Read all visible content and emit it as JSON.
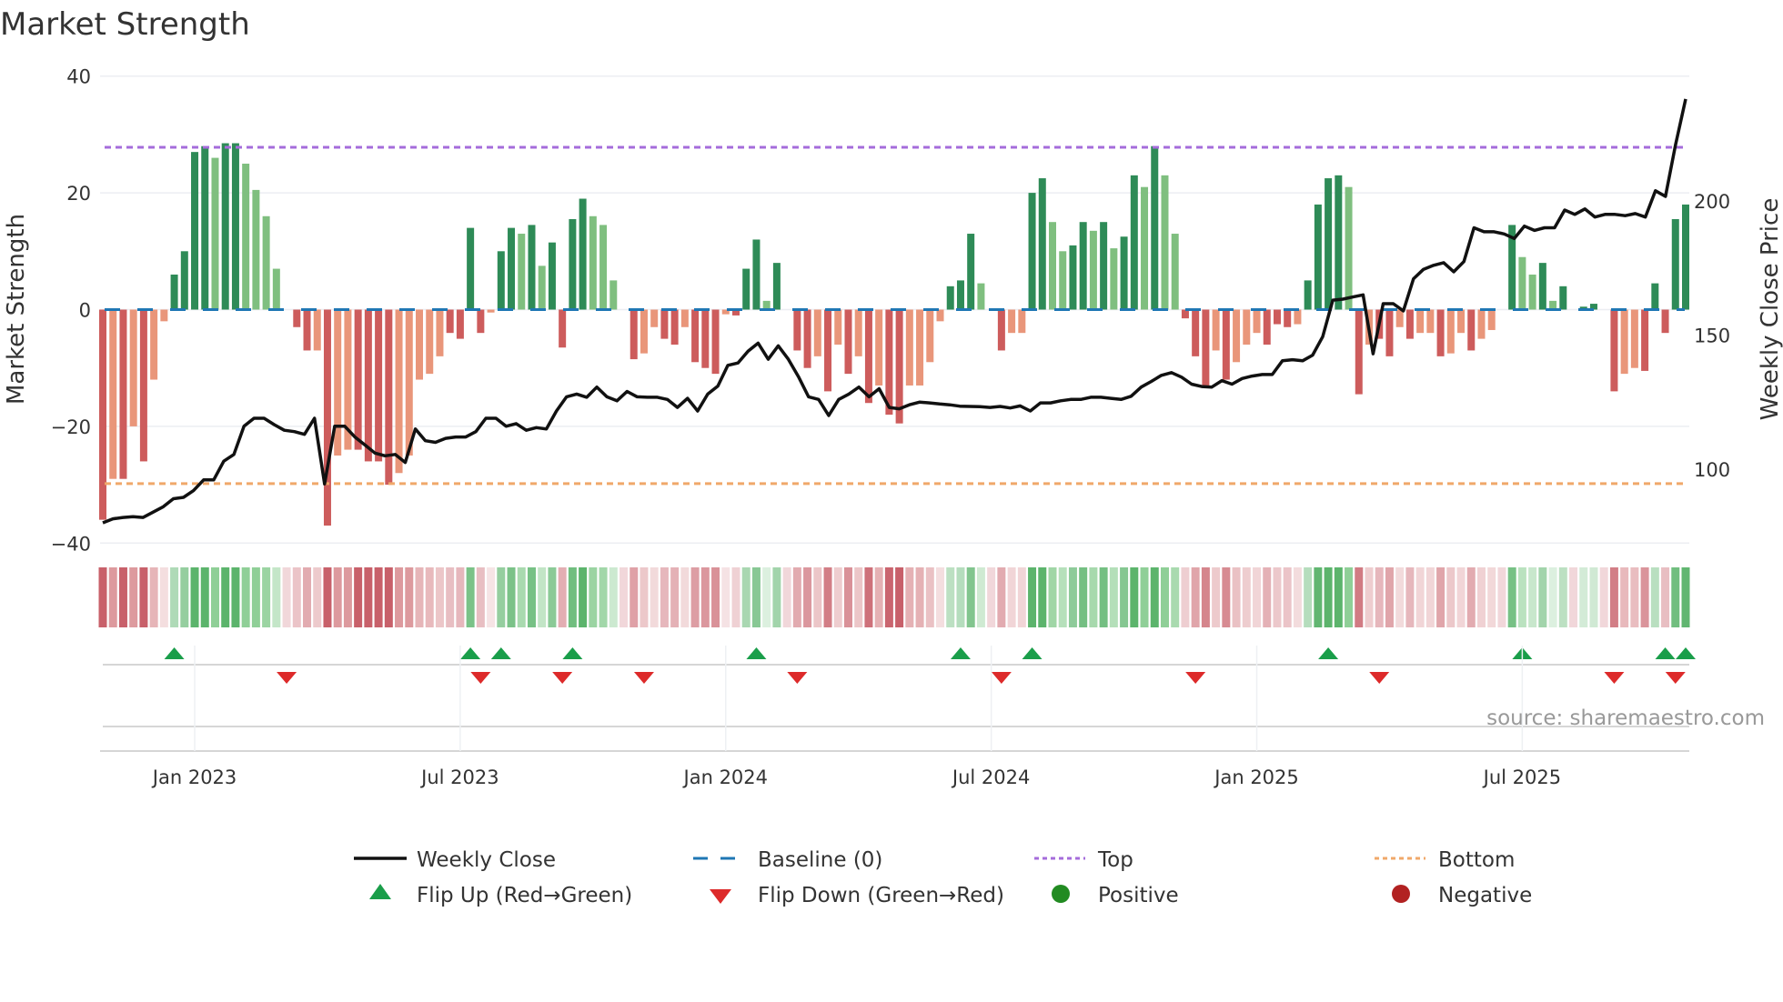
{
  "chart_data": {
    "type": "bar",
    "title": "Market Strength",
    "ylabel": "Market Strength",
    "y2label": "Weekly Close Price",
    "ylim": [
      -40,
      40
    ],
    "y2_ticks": [
      100,
      150,
      200
    ],
    "yticks": [
      -40,
      -20,
      0,
      20,
      40
    ],
    "ytick_labels": [
      "−40",
      "−20",
      "0",
      "20",
      "40"
    ],
    "y2tick_labels": [
      "100",
      "150",
      "200"
    ],
    "top_level": 27.8,
    "bottom_level": -29.8,
    "baseline": 0,
    "x_ticks": [
      {
        "week": 9,
        "label": "Jan 2023"
      },
      {
        "week": 35,
        "label": "Jul 2023"
      },
      {
        "week": 61,
        "label": "Jan 2024"
      },
      {
        "week": 87,
        "label": "Jul 2024"
      },
      {
        "week": 113,
        "label": "Jan 2025"
      },
      {
        "week": 139,
        "label": "Jul 2025"
      }
    ],
    "strength": [
      -36,
      -29,
      -29,
      -20,
      -26,
      -12,
      -2,
      6,
      10,
      27,
      28,
      26,
      28.5,
      28.5,
      25,
      20.5,
      16,
      7,
      0,
      -3,
      -7,
      -7,
      -37,
      -25,
      -24,
      -24,
      -26,
      -26,
      -30,
      -28,
      -25,
      -12,
      -11,
      -8,
      -4,
      -5,
      14,
      -4,
      -0.5,
      10,
      14,
      13,
      14.5,
      7.5,
      11.5,
      -6.5,
      15.5,
      19,
      16,
      14.5,
      5,
      0,
      -8.5,
      -7.5,
      -3,
      -5,
      -6,
      -3,
      -9,
      -10,
      -11,
      -0.8,
      -1,
      7,
      12,
      1.5,
      8,
      0,
      -7,
      -10,
      -8,
      -14,
      -6,
      -11,
      -8,
      -16,
      -13,
      -18,
      -19.5,
      -13,
      -13,
      -9,
      -2,
      4,
      5,
      13,
      4.5,
      0,
      -7,
      -4,
      -4,
      20,
      22.5,
      15,
      10,
      11,
      15,
      13.5,
      15,
      10.5,
      12.5,
      23,
      21,
      28,
      23,
      13,
      -1.5,
      -8,
      -13,
      -7,
      -12,
      -9,
      -6,
      -4,
      -6,
      -2.5,
      -3,
      -2.5,
      5,
      18,
      22.5,
      23,
      21,
      -14.5,
      -6,
      -5,
      -8,
      -3,
      -5,
      -4,
      -4,
      -8,
      -7.5,
      -4,
      -7,
      -5,
      -3.5,
      0,
      14.5,
      9,
      6,
      8,
      1.5,
      4,
      0,
      0.5,
      1,
      0,
      -14,
      -11,
      -10,
      -10.5,
      4.5,
      -4,
      15.5,
      18
    ],
    "shade": [
      "d",
      "l",
      "d",
      "l",
      "d",
      "l",
      "l",
      "d",
      "d",
      "d",
      "d",
      "l",
      "d",
      "d",
      "l",
      "l",
      "l",
      "l",
      "d",
      "d",
      "d",
      "l",
      "d",
      "l",
      "l",
      "d",
      "d",
      "d",
      "d",
      "l",
      "l",
      "l",
      "l",
      "l",
      "d",
      "d",
      "d",
      "d",
      "l",
      "d",
      "d",
      "l",
      "d",
      "l",
      "d",
      "d",
      "d",
      "d",
      "l",
      "l",
      "l",
      "d",
      "d",
      "l",
      "l",
      "d",
      "d",
      "l",
      "d",
      "d",
      "d",
      "l",
      "d",
      "d",
      "d",
      "l",
      "d",
      "d",
      "d",
      "d",
      "l",
      "d",
      "l",
      "d",
      "l",
      "d",
      "l",
      "d",
      "d",
      "l",
      "l",
      "l",
      "l",
      "d",
      "d",
      "d",
      "l",
      "d",
      "d",
      "l",
      "l",
      "d",
      "d",
      "l",
      "l",
      "d",
      "d",
      "l",
      "d",
      "l",
      "d",
      "d",
      "l",
      "d",
      "l",
      "l",
      "d",
      "d",
      "d",
      "l",
      "d",
      "l",
      "l",
      "l",
      "d",
      "d",
      "d",
      "l",
      "d",
      "d",
      "d",
      "d",
      "l",
      "d",
      "l",
      "d",
      "d",
      "l",
      "d",
      "l",
      "l",
      "d",
      "l",
      "l",
      "d",
      "l",
      "l",
      "d",
      "d",
      "l",
      "l",
      "d",
      "l",
      "d",
      "d",
      "d",
      "d",
      "d",
      "d",
      "l",
      "l",
      "d",
      "d",
      "d",
      "d",
      "d"
    ],
    "weekly_close": [
      80,
      81.5,
      82,
      82.3,
      82,
      84,
      86,
      89,
      89.5,
      92,
      96,
      96,
      103,
      105.5,
      116,
      119,
      119,
      116.6,
      114.5,
      114,
      113,
      119,
      94.5,
      116,
      116,
      112,
      109,
      106,
      105,
      105.5,
      102.5,
      115,
      110.6,
      110,
      111.5,
      112,
      112,
      114,
      119,
      119,
      116,
      117,
      114.5,
      115.5,
      115,
      121.7,
      127,
      128,
      126.8,
      130.6,
      127,
      125.5,
      129,
      127,
      126.8,
      126.8,
      126,
      123,
      126.4,
      121.7,
      128,
      131,
      138.7,
      139.6,
      144,
      147,
      141,
      146,
      141,
      134.5,
      127,
      126,
      120,
      126,
      128,
      130.6,
      127,
      130,
      123,
      122.5,
      124,
      125,
      124.7,
      124.3,
      124,
      123.5,
      123.4,
      123.3,
      123,
      123.4,
      122.8,
      123.6,
      121.7,
      124.7,
      124.7,
      125.5,
      126,
      126,
      126.8,
      126.8,
      126.4,
      126,
      127.2,
      130.6,
      132.7,
      135,
      136,
      134.3,
      131.7,
      130.8,
      130.6,
      133,
      131.7,
      133.8,
      134.7,
      135.3,
      135.3,
      140.4,
      140.8,
      140.4,
      142.5,
      149.4,
      163,
      163.4,
      164.2,
      165,
      143,
      161.7,
      161.7,
      159,
      171,
      174.5,
      176,
      177,
      173.6,
      177.4,
      190,
      188.5,
      188.5,
      187.7,
      186,
      190.6,
      189,
      190,
      190,
      196.6,
      195,
      197,
      194,
      195,
      195,
      194.5,
      195.3,
      194,
      203.8,
      201.7,
      221,
      238
    ],
    "flip_up_weeks": [
      7,
      36,
      39,
      46,
      64,
      84,
      91,
      120,
      139,
      153,
      155
    ],
    "flip_down_weeks": [
      18,
      37,
      45,
      53,
      68,
      88,
      107,
      125,
      148,
      154
    ],
    "legend": {
      "position": "bottom",
      "weekly_close": "Weekly Close",
      "baseline": "Baseline (0)",
      "top": "Top",
      "bottom": "Bottom",
      "flip_up": "Flip Up (Red→Green)",
      "flip_down": "Flip Down (Green→Red)",
      "positive": "Positive",
      "negative": "Negative"
    },
    "colors": {
      "pos_dark": "#2e8b57",
      "pos_light": "#7fbf7f",
      "neg_dark": "#cd5c5c",
      "neg_light": "#e9967a",
      "close": "#111111",
      "baseline": "#1f77b4",
      "top": "#a56cdb",
      "bottom": "#f0a86a",
      "flip_up": "#1a9e4a",
      "flip_down": "#dd2a2a",
      "positive": "#228b22",
      "negative": "#b22222"
    }
  },
  "source": "source: sharemaestro.com"
}
